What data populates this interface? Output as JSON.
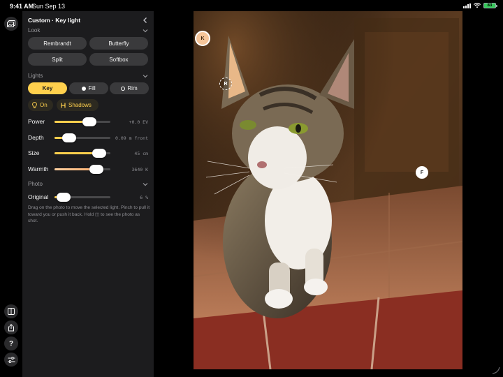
{
  "status": {
    "time": "9:41 AM",
    "date": "Sun Sep 13",
    "battery": "83"
  },
  "panel": {
    "title": "Custom · Key light",
    "look": {
      "label": "Look",
      "presets": [
        "Rembrandt",
        "Butterfly",
        "Split",
        "Softbox"
      ]
    },
    "lights": {
      "label": "Lights",
      "buttons": [
        "Key",
        "Fill",
        "Rim"
      ],
      "selected": "Key",
      "on_label": "On",
      "shadows_label": "Shadows"
    },
    "sliders": [
      {
        "label": "Power",
        "value": "+0.0 EV",
        "level": 0.62
      },
      {
        "label": "Depth",
        "value": "0.09 m front",
        "level": 0.26
      },
      {
        "label": "Size",
        "value": "45 cm",
        "level": 0.8
      },
      {
        "label": "Warmth",
        "value": "3640 K",
        "level": 0.75
      }
    ],
    "photo": {
      "label": "Photo",
      "slider": {
        "label": "Original",
        "value": "6 %",
        "level": 0.16
      }
    },
    "help": "Drag on the photo to move the selected light. Pinch to pull it toward you or push it back. Hold ◫ to see the photo as shot."
  },
  "photo_handles": {
    "key": "K",
    "rim": "R",
    "fill": "F"
  },
  "colors": {
    "accent": "#ffd04d",
    "panel": "#1c1c1e",
    "button": "#3a3a3c",
    "key_handle": "#f5c59a"
  },
  "icons": [
    "photo-library-icon",
    "compare-icon",
    "share-icon",
    "help-icon",
    "sliders-icon",
    "chevron-left-icon",
    "chevron-down-icon",
    "bulb-icon",
    "shadow-icon"
  ]
}
